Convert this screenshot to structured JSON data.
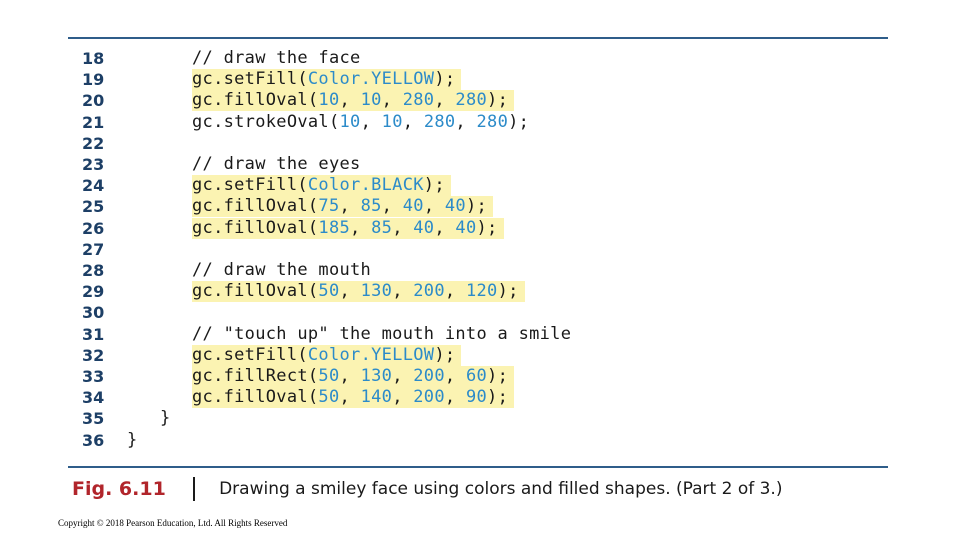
{
  "code_lines": [
    {
      "num": "18",
      "indent": 2,
      "highlight": false,
      "comment": true,
      "segments": [
        [
          "// draw the face",
          false
        ]
      ]
    },
    {
      "num": "19",
      "indent": 2,
      "highlight": true,
      "comment": false,
      "segments": [
        [
          "gc.setFill(",
          false
        ],
        [
          "Color.YELLOW",
          true
        ],
        [
          ");",
          false
        ]
      ]
    },
    {
      "num": "20",
      "indent": 2,
      "highlight": true,
      "comment": false,
      "segments": [
        [
          "gc.fillOval(",
          false
        ],
        [
          "10",
          true
        ],
        [
          ", ",
          false
        ],
        [
          "10",
          true
        ],
        [
          ", ",
          false
        ],
        [
          "280",
          true
        ],
        [
          ", ",
          false
        ],
        [
          "280",
          true
        ],
        [
          ");",
          false
        ]
      ]
    },
    {
      "num": "21",
      "indent": 2,
      "highlight": false,
      "comment": false,
      "segments": [
        [
          "gc.strokeOval(",
          false
        ],
        [
          "10",
          true
        ],
        [
          ", ",
          false
        ],
        [
          "10",
          true
        ],
        [
          ", ",
          false
        ],
        [
          "280",
          true
        ],
        [
          ", ",
          false
        ],
        [
          "280",
          true
        ],
        [
          ");",
          false
        ]
      ]
    },
    {
      "num": "22",
      "indent": 2,
      "highlight": false,
      "comment": false,
      "segments": []
    },
    {
      "num": "23",
      "indent": 2,
      "highlight": false,
      "comment": true,
      "segments": [
        [
          "// draw the eyes",
          false
        ]
      ]
    },
    {
      "num": "24",
      "indent": 2,
      "highlight": true,
      "comment": false,
      "segments": [
        [
          "gc.setFill(",
          false
        ],
        [
          "Color.BLACK",
          true
        ],
        [
          ");",
          false
        ]
      ]
    },
    {
      "num": "25",
      "indent": 2,
      "highlight": true,
      "comment": false,
      "segments": [
        [
          "gc.fillOval(",
          false
        ],
        [
          "75",
          true
        ],
        [
          ", ",
          false
        ],
        [
          "85",
          true
        ],
        [
          ", ",
          false
        ],
        [
          "40",
          true
        ],
        [
          ", ",
          false
        ],
        [
          "40",
          true
        ],
        [
          ");",
          false
        ]
      ]
    },
    {
      "num": "26",
      "indent": 2,
      "highlight": true,
      "comment": false,
      "segments": [
        [
          "gc.fillOval(",
          false
        ],
        [
          "185",
          true
        ],
        [
          ", ",
          false
        ],
        [
          "85",
          true
        ],
        [
          ", ",
          false
        ],
        [
          "40",
          true
        ],
        [
          ", ",
          false
        ],
        [
          "40",
          true
        ],
        [
          ");",
          false
        ]
      ]
    },
    {
      "num": "27",
      "indent": 2,
      "highlight": false,
      "comment": false,
      "segments": []
    },
    {
      "num": "28",
      "indent": 2,
      "highlight": false,
      "comment": true,
      "segments": [
        [
          "// draw the mouth",
          false
        ]
      ]
    },
    {
      "num": "29",
      "indent": 2,
      "highlight": true,
      "comment": false,
      "segments": [
        [
          "gc.fillOval(",
          false
        ],
        [
          "50",
          true
        ],
        [
          ", ",
          false
        ],
        [
          "130",
          true
        ],
        [
          ", ",
          false
        ],
        [
          "200",
          true
        ],
        [
          ", ",
          false
        ],
        [
          "120",
          true
        ],
        [
          ");",
          false
        ]
      ]
    },
    {
      "num": "30",
      "indent": 2,
      "highlight": false,
      "comment": false,
      "segments": []
    },
    {
      "num": "31",
      "indent": 2,
      "highlight": false,
      "comment": true,
      "segments": [
        [
          "// \"touch up\" the mouth into a smile",
          false
        ]
      ]
    },
    {
      "num": "32",
      "indent": 2,
      "highlight": true,
      "comment": false,
      "segments": [
        [
          "gc.setFill(",
          false
        ],
        [
          "Color.YELLOW",
          true
        ],
        [
          ");",
          false
        ]
      ]
    },
    {
      "num": "33",
      "indent": 2,
      "highlight": true,
      "comment": false,
      "segments": [
        [
          "gc.fillRect(",
          false
        ],
        [
          "50",
          true
        ],
        [
          ", ",
          false
        ],
        [
          "130",
          true
        ],
        [
          ", ",
          false
        ],
        [
          "200",
          true
        ],
        [
          ", ",
          false
        ],
        [
          "60",
          true
        ],
        [
          ");",
          false
        ]
      ]
    },
    {
      "num": "34",
      "indent": 2,
      "highlight": true,
      "comment": false,
      "segments": [
        [
          "gc.fillOval(",
          false
        ],
        [
          "50",
          true
        ],
        [
          ", ",
          false
        ],
        [
          "140",
          true
        ],
        [
          ", ",
          false
        ],
        [
          "200",
          true
        ],
        [
          ", ",
          false
        ],
        [
          "90",
          true
        ],
        [
          ");",
          false
        ]
      ]
    },
    {
      "num": "35",
      "indent": 1,
      "highlight": false,
      "comment": false,
      "segments": [
        [
          "}",
          false
        ]
      ]
    },
    {
      "num": "36",
      "indent": 0,
      "highlight": false,
      "comment": false,
      "segments": [
        [
          "}",
          false
        ]
      ]
    }
  ],
  "caption": {
    "label": "Fig. 6.11",
    "text": "Drawing a smiley face using colors and filled shapes. (Part 2 of 3.)"
  },
  "copyright": "Copyright © 2018 Pearson Education, Ltd. All Rights Reserved",
  "colors": {
    "literal": "#2c8bc9",
    "highlight": "#fbf3b2",
    "rule": "#2f5d8a",
    "line_number": "#1d3f66",
    "figure_label": "#b1252b"
  }
}
